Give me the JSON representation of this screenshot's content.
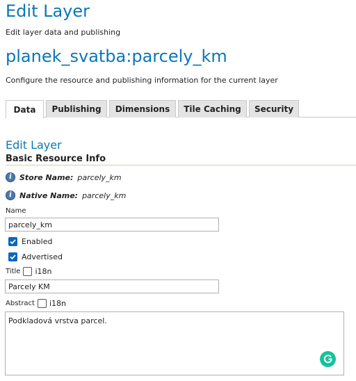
{
  "header": {
    "title": "Edit Layer",
    "subtitle": "Edit layer data and publishing",
    "layer_name": "planek_svatba:parcely_km",
    "layer_description": "Configure the resource and publishing information for the current layer"
  },
  "tabs": [
    {
      "label": "Data",
      "active": true
    },
    {
      "label": "Publishing",
      "active": false
    },
    {
      "label": "Dimensions",
      "active": false
    },
    {
      "label": "Tile Caching",
      "active": false
    },
    {
      "label": "Security",
      "active": false
    }
  ],
  "section": {
    "title": "Edit Layer",
    "subtitle": "Basic Resource Info"
  },
  "info": {
    "store": {
      "key": "Store Name:",
      "value": "parcely_km",
      "icon": "info-icon"
    },
    "native": {
      "key": "Native Name:",
      "value": "parcely_km",
      "icon": "info-icon"
    }
  },
  "form": {
    "name_label": "Name",
    "name_value": "parcely_km",
    "enabled_label": "Enabled",
    "enabled_checked": true,
    "advertised_label": "Advertised",
    "advertised_checked": true,
    "title_label": "Title",
    "title_i18n_label": "i18n",
    "title_i18n_checked": false,
    "title_value": "Parcely KM",
    "abstract_label": "Abstract",
    "abstract_i18n_label": "i18n",
    "abstract_i18n_checked": false,
    "abstract_value": "Podkladová vrstva parcel."
  },
  "colors": {
    "accent": "#0b77b6",
    "checkbox": "#0a66c2",
    "grammarly": "#15c39a"
  }
}
